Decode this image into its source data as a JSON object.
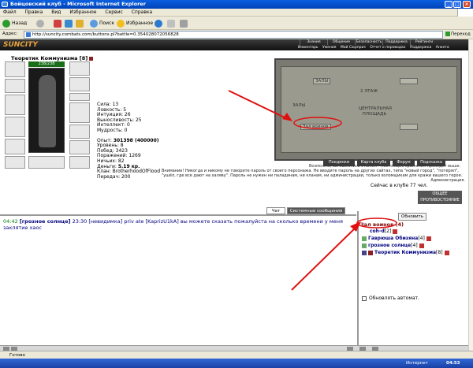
{
  "window": {
    "title": "Бойцовский клуб - Microsoft Internet Explorer"
  },
  "menu": [
    "Файл",
    "Правка",
    "Вид",
    "Избранное",
    "Сервис",
    "Справка"
  ],
  "toolbar": {
    "back": "Назад",
    "search": "Поиск",
    "favorites": "Избранное"
  },
  "address": {
    "label": "Адрес:",
    "url": "http://suncity.combats.com/buttons.pl?battle=0.354028072056828",
    "go": "Переход"
  },
  "site": {
    "logo": "SUNCITY",
    "nav1": [
      "Знания",
      "Общение",
      "Безопасность",
      "Поддержка",
      "Рейтинги"
    ],
    "nav2": [
      "Инвентарь",
      "Умения",
      "Мой Сюрприз",
      "Отчет о переводах",
      "Поддержка",
      "Анкета"
    ]
  },
  "character": {
    "name": "Теоретик Коммунизма [8]",
    "hp": "238/238",
    "stats": [
      {
        "label": "Сила: ",
        "value": "13"
      },
      {
        "label": "Ловкость: ",
        "value": "5"
      },
      {
        "label": "Интуиция: ",
        "value": "26"
      },
      {
        "label": "Выносливость: ",
        "value": "25"
      },
      {
        "label": "Интеллект: ",
        "value": "0"
      },
      {
        "label": "Мудрость: ",
        "value": "0"
      }
    ],
    "info": [
      {
        "label": "Опыт: ",
        "value": "301398 (400000)"
      },
      {
        "label": "Уровень: ",
        "value": "8"
      },
      {
        "label": "Побед: ",
        "value": "3423"
      },
      {
        "label": "Поражений: ",
        "value": "1269"
      },
      {
        "label": "Ничьих: ",
        "value": "82"
      },
      {
        "label": "Деньги: ",
        "value": "5.19 кр."
      },
      {
        "label": "Клан: ",
        "value": "BrotherhoodOfFlood"
      },
      {
        "label": "Передач: ",
        "value": "200"
      }
    ]
  },
  "map": {
    "labels": [
      "ЗАЛЫ",
      "2 ЭТАЖ",
      "ЗАЛЫ",
      "ЦЕНТРАЛЬНАЯ ПЛОЩАДЬ",
      "Зал воинов",
      "Зал воинов"
    ],
    "caption": "Возможно, вы ошиблись этажом - настоящие сражения проходят выше."
  },
  "actions": [
    "Поединки",
    "Карта клуба",
    "Форум",
    "Подсказка"
  ],
  "notice": "Внимание! Никогда и никому не говорите пароль от своего персонажа. Не вводите пароль на других сайтах, типа \"новый город\", \"потерял\", \"ушёл, где все дают на халяву\". Пароль не нужен ни паладинам, ни кланам, ни администрации, только взломщикам для кражи вашего героя.",
  "admin": "Администрация.",
  "online": "Сейчас в клубе 77 чел.",
  "counter": "ОБЩЕЕ ПРОТИВОСТОЯНИЕ",
  "chat": {
    "tabs": [
      "Чат",
      "Системные сообщения"
    ],
    "messages": [
      {
        "time": "04:42",
        "nick": "[грозное солнце]",
        "time2": "23:30",
        "text": "[невидимка] priv ate [KaprizU1kA] вы можете сказать пожалуйста на сколько времени у меня заклятие хаос"
      }
    ]
  },
  "room": {
    "refresh": "Обновить",
    "name": "Зал воинов (4)",
    "users": [
      {
        "name": "coh-d",
        "level": "[2]"
      },
      {
        "name": "Гаврюша Обизяна",
        "level": "[4]"
      },
      {
        "name": "грозное солнце",
        "level": "[4]"
      },
      {
        "name": "Теоретик Коммунизма",
        "level": "[8]"
      }
    ],
    "auto": "Обновлять автомат."
  },
  "status": "Готово",
  "taskbar": {
    "internet": "Интернет",
    "time": "04:53"
  },
  "colors": {
    "accent": "#e8a23c",
    "annotation": "#e01010",
    "ie_blue": "#0a5fe0"
  }
}
